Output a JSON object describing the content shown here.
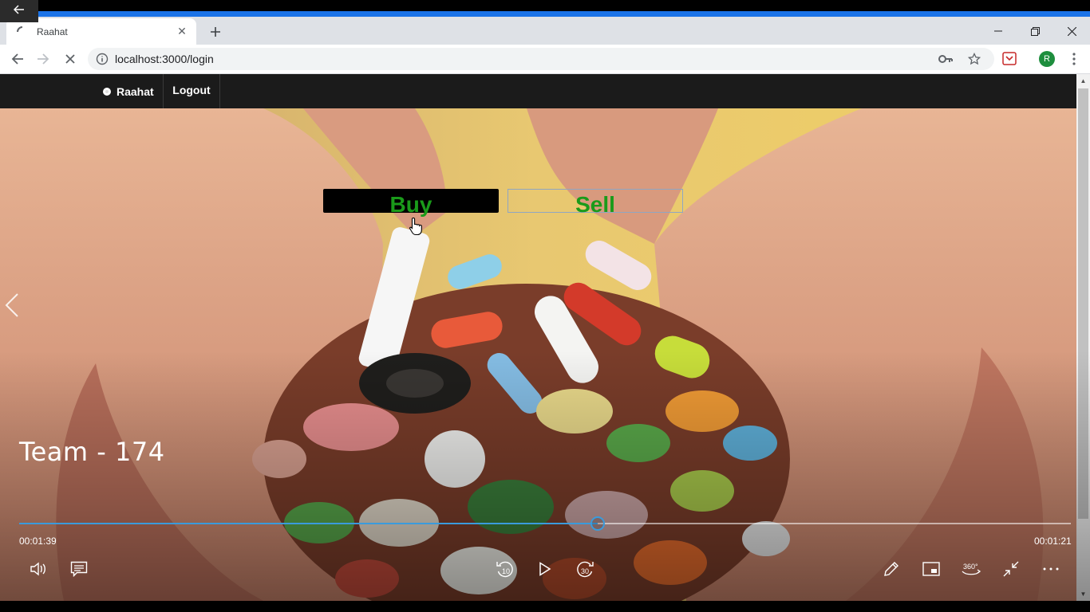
{
  "player": {
    "title": "Team - 174",
    "time_elapsed": "00:01:39",
    "time_remaining": "00:01:21",
    "progress": 0.55
  },
  "browser": {
    "tab_title": "Raahat",
    "url": "localhost:3000/login",
    "profile_initial": "R"
  },
  "site": {
    "brand": "Raahat",
    "logout": "Logout",
    "buy_label": "Buy",
    "sell_label": "Sell"
  },
  "colors": {
    "accent": "#3a9bdc",
    "button_text": "#1a9b1a",
    "navbar": "#1b1b1b",
    "load_bar": "#1a73e8"
  }
}
